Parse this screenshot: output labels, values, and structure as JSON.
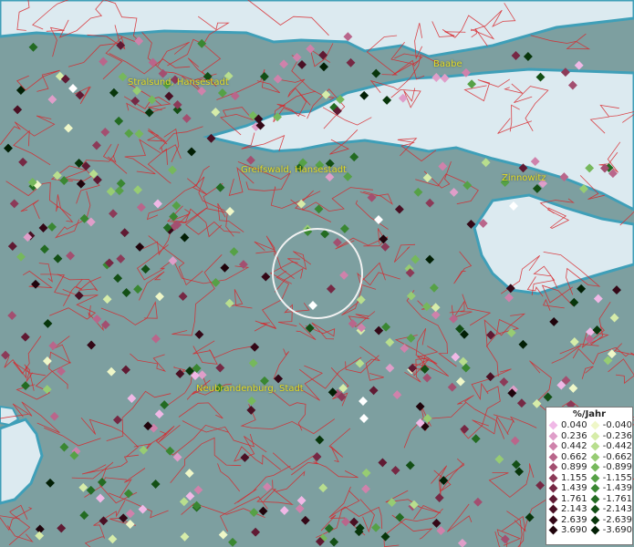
{
  "places": [
    {
      "name": "Stralsund, Hansestadt"
    },
    {
      "name": "Baabe"
    },
    {
      "name": "Greifswald, Hansestadt"
    },
    {
      "name": "Zinnowitz"
    },
    {
      "name": "Neubrandenburg, Stadt"
    }
  ],
  "legend": {
    "title": "%/Jahr",
    "positive": [
      {
        "label": "0.040",
        "color": "#f0b8e6"
      },
      {
        "label": "0.236",
        "color": "#df9ec9"
      },
      {
        "label": "0.442",
        "color": "#cf82ab"
      },
      {
        "label": "0.662",
        "color": "#b9668b"
      },
      {
        "label": "0.899",
        "color": "#a34f70"
      },
      {
        "label": "1.155",
        "color": "#8c3a58"
      },
      {
        "label": "1.439",
        "color": "#762844"
      },
      {
        "label": "1.761",
        "color": "#601a33"
      },
      {
        "label": "2.143",
        "color": "#4a1024"
      },
      {
        "label": "2.639",
        "color": "#340817"
      },
      {
        "label": "3.690",
        "color": "#20040c"
      }
    ],
    "negative": [
      {
        "label": "-0.040",
        "color": "#eff7c8"
      },
      {
        "label": "-0.236",
        "color": "#d6eca9"
      },
      {
        "label": "-0.442",
        "color": "#b8de8e"
      },
      {
        "label": "-0.662",
        "color": "#97cc73"
      },
      {
        "label": "-0.899",
        "color": "#76b85c"
      },
      {
        "label": "-1.155",
        "color": "#56a146"
      },
      {
        "label": "-1.439",
        "color": "#3a8732"
      },
      {
        "label": "-1.761",
        "color": "#236b22"
      },
      {
        "label": "-2.143",
        "color": "#134f15"
      },
      {
        "label": "-2.639",
        "color": "#08360b"
      },
      {
        "label": "-3.690",
        "color": "#021f05"
      }
    ]
  },
  "colors": {
    "land": "#7d9fa0",
    "water": "#dceaf0",
    "coast": "#3f9fb8",
    "borders": "#d8262a",
    "place_label": "#e4dc25"
  }
}
